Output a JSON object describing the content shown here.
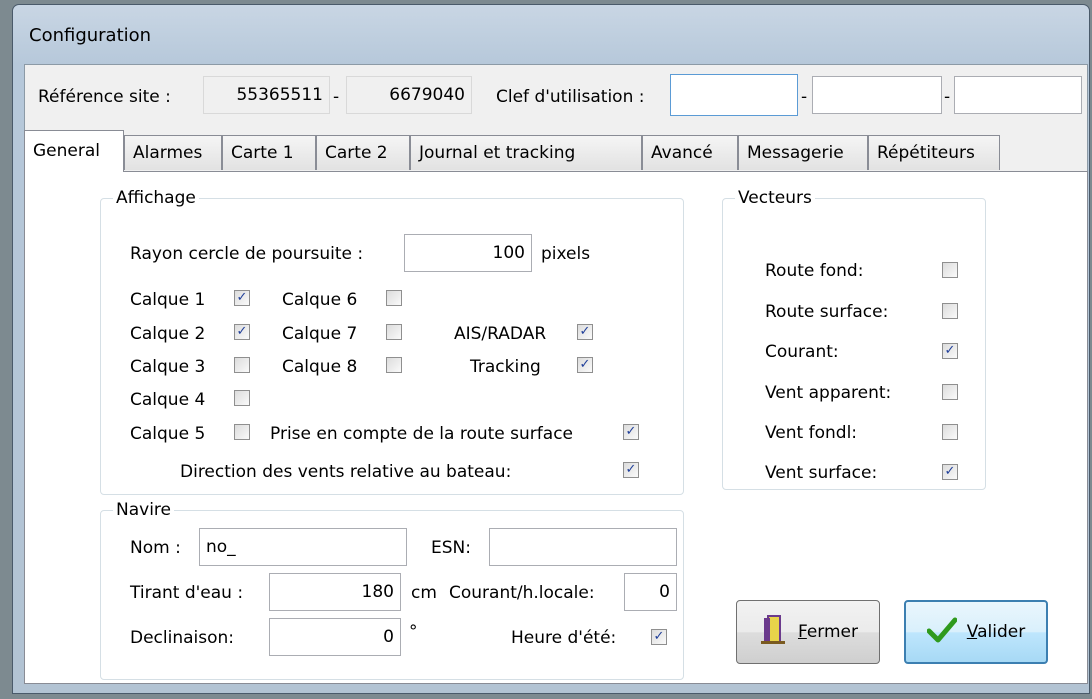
{
  "window": {
    "title": "Configuration"
  },
  "header": {
    "reference_label": "Référence site :",
    "ref_value_1": "55365511",
    "ref_dash": "-",
    "ref_value_2": "6679040",
    "key_label": "Clef d'utilisation :",
    "key_value_1": "",
    "key_dash_1": "-",
    "key_value_2": "",
    "key_dash_2": "-",
    "key_value_3": ""
  },
  "tabs": [
    {
      "label": "General",
      "active": true
    },
    {
      "label": "Alarmes"
    },
    {
      "label": "Carte 1"
    },
    {
      "label": "Carte 2"
    },
    {
      "label": "Journal et tracking"
    },
    {
      "label": "Avancé"
    },
    {
      "label": "Messagerie"
    },
    {
      "label": "Répétiteurs"
    }
  ],
  "affichage": {
    "legend": "Affichage",
    "rayon_label": "Rayon cercle de poursuite :",
    "rayon_value": "100",
    "rayon_unit": "pixels",
    "calques": [
      {
        "label": "Calque 1",
        "checked": true
      },
      {
        "label": "Calque 2",
        "checked": true
      },
      {
        "label": "Calque 3",
        "checked": false
      },
      {
        "label": "Calque 4",
        "checked": false
      },
      {
        "label": "Calque 5",
        "checked": false
      },
      {
        "label": "Calque 6",
        "checked": false
      },
      {
        "label": "Calque 7",
        "checked": false
      },
      {
        "label": "Calque 8",
        "checked": false
      }
    ],
    "ais_label": "AIS/RADAR",
    "ais_checked": true,
    "tracking_label": "Tracking",
    "tracking_checked": true,
    "prise_label": "Prise en compte de la route surface",
    "prise_checked": true,
    "direction_label": "Direction des vents relative au bateau:",
    "direction_checked": true
  },
  "vecteurs": {
    "legend": "Vecteurs",
    "items": [
      {
        "label": "Route fond:",
        "checked": false
      },
      {
        "label": "Route surface:",
        "checked": false
      },
      {
        "label": "Courant:",
        "checked": true
      },
      {
        "label": "Vent apparent:",
        "checked": false
      },
      {
        "label": "Vent fondl:",
        "checked": false
      },
      {
        "label": "Vent surface:",
        "checked": true
      }
    ]
  },
  "navire": {
    "legend": "Navire",
    "nom_label": "Nom :",
    "nom_value": "no_",
    "esn_label": "ESN:",
    "esn_value": "",
    "tirant_label": "Tirant d'eau :",
    "tirant_value": "180",
    "tirant_unit": "cm",
    "courant_label": "Courant/h.locale:",
    "courant_value": "0",
    "declinaison_label": "Declinaison:",
    "declinaison_value": "0",
    "declinaison_unit": "°",
    "heure_label": "Heure d'été:",
    "heure_checked": true
  },
  "buttons": {
    "fermer_first": "F",
    "fermer_rest": "ermer",
    "valider_first": "V",
    "valider_rest": "alider"
  },
  "colors": {
    "check": "#21409a",
    "valider_check": "#2f9a1d",
    "fermer_icon": "#6b3a8c"
  },
  "icons": {
    "fermer": "door-exit-icon",
    "valider": "checkmark-icon",
    "checkbox_mark": "✓"
  }
}
